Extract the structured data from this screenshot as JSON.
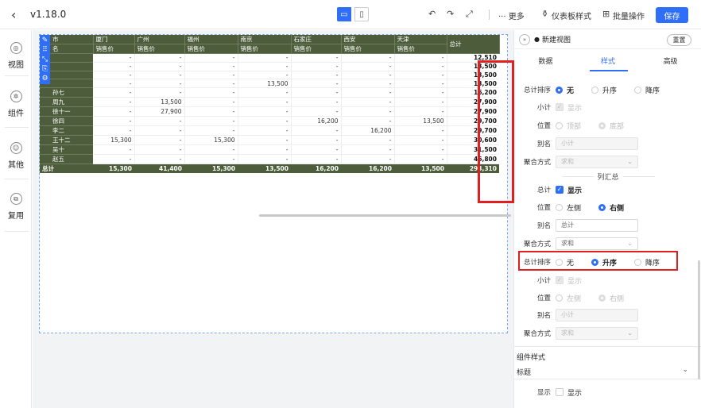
{
  "topbar": {
    "back_icon": "‹",
    "version": "v1.18.0",
    "more": "··· 更多",
    "dashboard_style": "仪表板样式",
    "batch_ops": "批量操作",
    "save": "保存"
  },
  "rail": [
    {
      "icon": "◎",
      "label": "视图"
    },
    {
      "icon": "✲",
      "label": "组件"
    },
    {
      "icon": "☺",
      "label": "其他"
    },
    {
      "icon": "⧉",
      "label": "复用"
    }
  ],
  "pivot": {
    "header_cities": [
      "厦门",
      "广州",
      "福州",
      "南京",
      "石家庄",
      "西安",
      "天津"
    ],
    "sub_header": "销售价",
    "total_label": "总计",
    "corner_top": "市",
    "corner_bottom": "名",
    "rows": [
      {
        "name": "",
        "vals": [
          "-",
          "-",
          "-",
          "-",
          "-",
          "-",
          "-"
        ],
        "total": "12,510"
      },
      {
        "name": "",
        "vals": [
          "-",
          "-",
          "-",
          "-",
          "-",
          "-",
          "-"
        ],
        "total": "13,500"
      },
      {
        "name": "",
        "vals": [
          "-",
          "-",
          "-",
          "-",
          "-",
          "-",
          "-"
        ],
        "total": "13,500"
      },
      {
        "name": "",
        "vals": [
          "-",
          "-",
          "-",
          "13,500",
          "-",
          "-",
          "-"
        ],
        "total": "13,500"
      },
      {
        "name": "孙七",
        "vals": [
          "-",
          "-",
          "-",
          "-",
          "-",
          "-",
          "-"
        ],
        "total": "16,200"
      },
      {
        "name": "周九",
        "vals": [
          "-",
          "13,500",
          "-",
          "-",
          "-",
          "-",
          "-"
        ],
        "total": "27,900"
      },
      {
        "name": "徐十一",
        "vals": [
          "-",
          "27,900",
          "-",
          "-",
          "-",
          "-",
          "-"
        ],
        "total": "27,900"
      },
      {
        "name": "徐四",
        "vals": [
          "-",
          "-",
          "-",
          "-",
          "16,200",
          "-",
          "13,500"
        ],
        "total": "29,700"
      },
      {
        "name": "李二",
        "vals": [
          "-",
          "-",
          "-",
          "-",
          "-",
          "16,200",
          "-"
        ],
        "total": "29,700"
      },
      {
        "name": "王十二",
        "vals": [
          "15,300",
          "-",
          "15,300",
          "-",
          "-",
          "-",
          "-"
        ],
        "total": "30,600"
      },
      {
        "name": "吴十",
        "vals": [
          "-",
          "-",
          "-",
          "-",
          "-",
          "-",
          "-"
        ],
        "total": "31,500"
      },
      {
        "name": "赵五",
        "vals": [
          "-",
          "-",
          "-",
          "-",
          "-",
          "-",
          "-"
        ],
        "total": "46,800"
      }
    ],
    "sum_row": {
      "name": "总计",
      "vals": [
        "15,300",
        "41,400",
        "15,300",
        "13,500",
        "16,200",
        "16,200",
        "13,500"
      ],
      "total": "293,310"
    }
  },
  "panel": {
    "expand_icon": "»",
    "view_title": "新建视图",
    "reset": "重置",
    "tabs": [
      "数据",
      "样式",
      "高级"
    ],
    "row_total_sort_label": "总计排序",
    "opt_none": "无",
    "opt_asc": "升序",
    "opt_desc": "降序",
    "subtotal_label": "小计",
    "display": "显示",
    "position_label": "位置",
    "opt_top": "顶部",
    "opt_bottom": "底部",
    "alias_label": "别名",
    "subtotal_alias": "小计",
    "agg_label": "聚合方式",
    "agg_value": "求和",
    "col_summary": "列汇总",
    "total_label": "总计",
    "opt_left": "左侧",
    "opt_right": "右侧",
    "total_alias": "总计",
    "component_style": "组件样式",
    "title_label": "标题"
  }
}
